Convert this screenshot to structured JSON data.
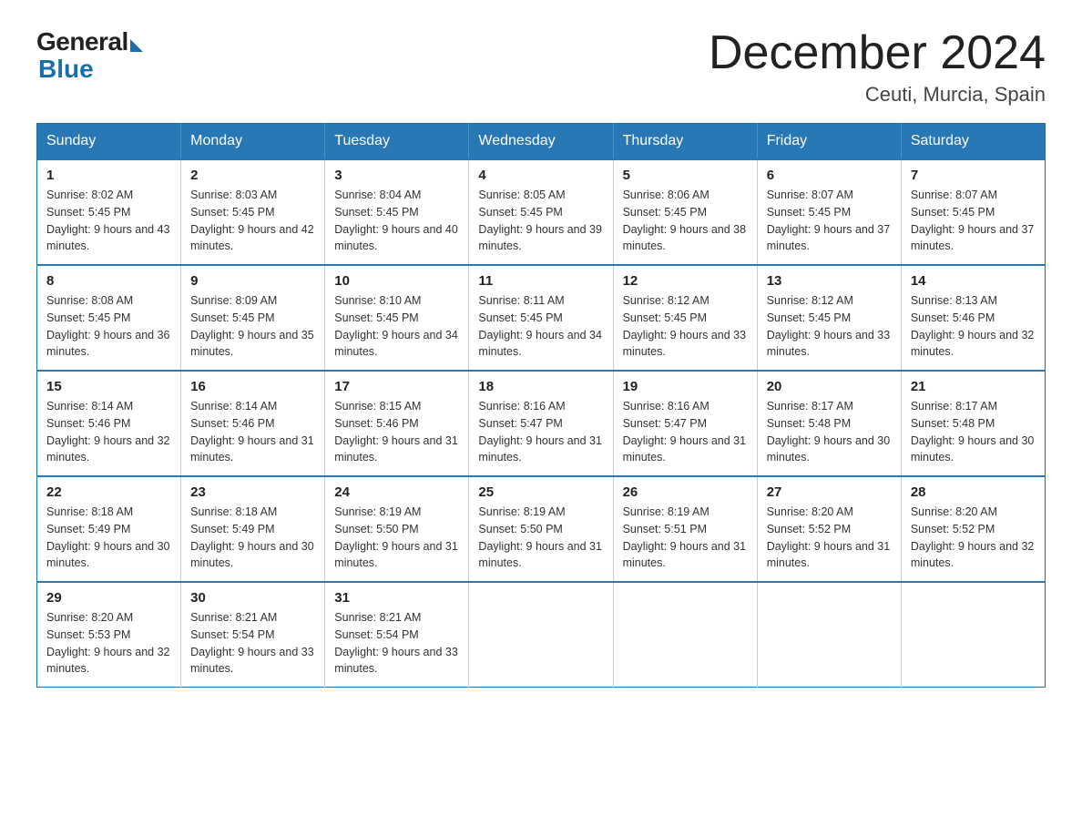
{
  "logo": {
    "general": "General",
    "blue": "Blue"
  },
  "title": "December 2024",
  "subtitle": "Ceuti, Murcia, Spain",
  "days_header": [
    "Sunday",
    "Monday",
    "Tuesday",
    "Wednesday",
    "Thursday",
    "Friday",
    "Saturday"
  ],
  "weeks": [
    [
      {
        "day": "1",
        "sunrise": "8:02 AM",
        "sunset": "5:45 PM",
        "daylight": "9 hours and 43 minutes."
      },
      {
        "day": "2",
        "sunrise": "8:03 AM",
        "sunset": "5:45 PM",
        "daylight": "9 hours and 42 minutes."
      },
      {
        "day": "3",
        "sunrise": "8:04 AM",
        "sunset": "5:45 PM",
        "daylight": "9 hours and 40 minutes."
      },
      {
        "day": "4",
        "sunrise": "8:05 AM",
        "sunset": "5:45 PM",
        "daylight": "9 hours and 39 minutes."
      },
      {
        "day": "5",
        "sunrise": "8:06 AM",
        "sunset": "5:45 PM",
        "daylight": "9 hours and 38 minutes."
      },
      {
        "day": "6",
        "sunrise": "8:07 AM",
        "sunset": "5:45 PM",
        "daylight": "9 hours and 37 minutes."
      },
      {
        "day": "7",
        "sunrise": "8:07 AM",
        "sunset": "5:45 PM",
        "daylight": "9 hours and 37 minutes."
      }
    ],
    [
      {
        "day": "8",
        "sunrise": "8:08 AM",
        "sunset": "5:45 PM",
        "daylight": "9 hours and 36 minutes."
      },
      {
        "day": "9",
        "sunrise": "8:09 AM",
        "sunset": "5:45 PM",
        "daylight": "9 hours and 35 minutes."
      },
      {
        "day": "10",
        "sunrise": "8:10 AM",
        "sunset": "5:45 PM",
        "daylight": "9 hours and 34 minutes."
      },
      {
        "day": "11",
        "sunrise": "8:11 AM",
        "sunset": "5:45 PM",
        "daylight": "9 hours and 34 minutes."
      },
      {
        "day": "12",
        "sunrise": "8:12 AM",
        "sunset": "5:45 PM",
        "daylight": "9 hours and 33 minutes."
      },
      {
        "day": "13",
        "sunrise": "8:12 AM",
        "sunset": "5:45 PM",
        "daylight": "9 hours and 33 minutes."
      },
      {
        "day": "14",
        "sunrise": "8:13 AM",
        "sunset": "5:46 PM",
        "daylight": "9 hours and 32 minutes."
      }
    ],
    [
      {
        "day": "15",
        "sunrise": "8:14 AM",
        "sunset": "5:46 PM",
        "daylight": "9 hours and 32 minutes."
      },
      {
        "day": "16",
        "sunrise": "8:14 AM",
        "sunset": "5:46 PM",
        "daylight": "9 hours and 31 minutes."
      },
      {
        "day": "17",
        "sunrise": "8:15 AM",
        "sunset": "5:46 PM",
        "daylight": "9 hours and 31 minutes."
      },
      {
        "day": "18",
        "sunrise": "8:16 AM",
        "sunset": "5:47 PM",
        "daylight": "9 hours and 31 minutes."
      },
      {
        "day": "19",
        "sunrise": "8:16 AM",
        "sunset": "5:47 PM",
        "daylight": "9 hours and 31 minutes."
      },
      {
        "day": "20",
        "sunrise": "8:17 AM",
        "sunset": "5:48 PM",
        "daylight": "9 hours and 30 minutes."
      },
      {
        "day": "21",
        "sunrise": "8:17 AM",
        "sunset": "5:48 PM",
        "daylight": "9 hours and 30 minutes."
      }
    ],
    [
      {
        "day": "22",
        "sunrise": "8:18 AM",
        "sunset": "5:49 PM",
        "daylight": "9 hours and 30 minutes."
      },
      {
        "day": "23",
        "sunrise": "8:18 AM",
        "sunset": "5:49 PM",
        "daylight": "9 hours and 30 minutes."
      },
      {
        "day": "24",
        "sunrise": "8:19 AM",
        "sunset": "5:50 PM",
        "daylight": "9 hours and 31 minutes."
      },
      {
        "day": "25",
        "sunrise": "8:19 AM",
        "sunset": "5:50 PM",
        "daylight": "9 hours and 31 minutes."
      },
      {
        "day": "26",
        "sunrise": "8:19 AM",
        "sunset": "5:51 PM",
        "daylight": "9 hours and 31 minutes."
      },
      {
        "day": "27",
        "sunrise": "8:20 AM",
        "sunset": "5:52 PM",
        "daylight": "9 hours and 31 minutes."
      },
      {
        "day": "28",
        "sunrise": "8:20 AM",
        "sunset": "5:52 PM",
        "daylight": "9 hours and 32 minutes."
      }
    ],
    [
      {
        "day": "29",
        "sunrise": "8:20 AM",
        "sunset": "5:53 PM",
        "daylight": "9 hours and 32 minutes."
      },
      {
        "day": "30",
        "sunrise": "8:21 AM",
        "sunset": "5:54 PM",
        "daylight": "9 hours and 33 minutes."
      },
      {
        "day": "31",
        "sunrise": "8:21 AM",
        "sunset": "5:54 PM",
        "daylight": "9 hours and 33 minutes."
      },
      null,
      null,
      null,
      null
    ]
  ]
}
